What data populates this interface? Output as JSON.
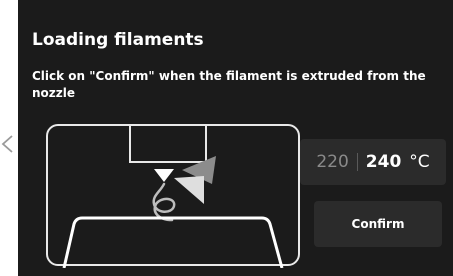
{
  "dialog": {
    "title": "Loading filaments",
    "instruction": "Click on \"Confirm\" when the filament is extruded from the nozzle"
  },
  "temperature": {
    "current": "220",
    "target": "240",
    "unit": "°C"
  },
  "actions": {
    "confirm_label": "Confirm"
  },
  "icons": {
    "back": "chevron-left-icon",
    "illustration": "nozzle-extrusion-illustration"
  },
  "colors": {
    "background": "#1b1b1b",
    "panel": "#2b2b2b",
    "text": "#ffffff",
    "muted": "#8a8a8a"
  }
}
